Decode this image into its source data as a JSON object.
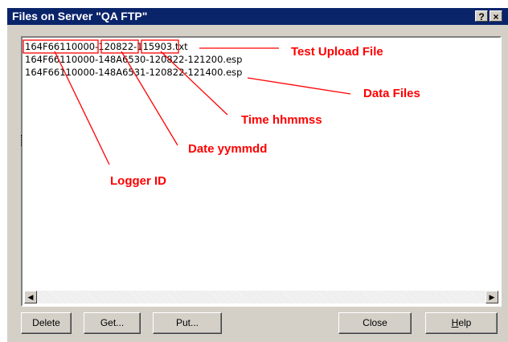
{
  "window": {
    "title": "Files on Server \"QA FTP\"",
    "help_glyph": "?",
    "close_glyph": "×"
  },
  "files": [
    "164F66110000-120822-115903.txt",
    "164F66110000-148A6530-120822-121200.esp",
    "164F66110000-148A6531-120822-121400.esp"
  ],
  "annotations": {
    "test_upload_file": "Test Upload File",
    "data_files": "Data Files",
    "time": "Time hhmmss",
    "date": "Date yymmdd",
    "logger_id": "Logger ID"
  },
  "scrollbar": {
    "left_arrow": "◀",
    "right_arrow": "▶"
  },
  "buttons": {
    "delete": "Delete",
    "get": "Get...",
    "put": "Put...",
    "close": "Close",
    "help_prefix": "H",
    "help_rest": "elp"
  },
  "colors": {
    "annotation": "#ff0000",
    "titlebar": "#0a246a",
    "dialog": "#d4d0c8"
  },
  "icons": [
    "help-icon",
    "close-icon",
    "scroll-left-icon",
    "scroll-right-icon"
  ]
}
